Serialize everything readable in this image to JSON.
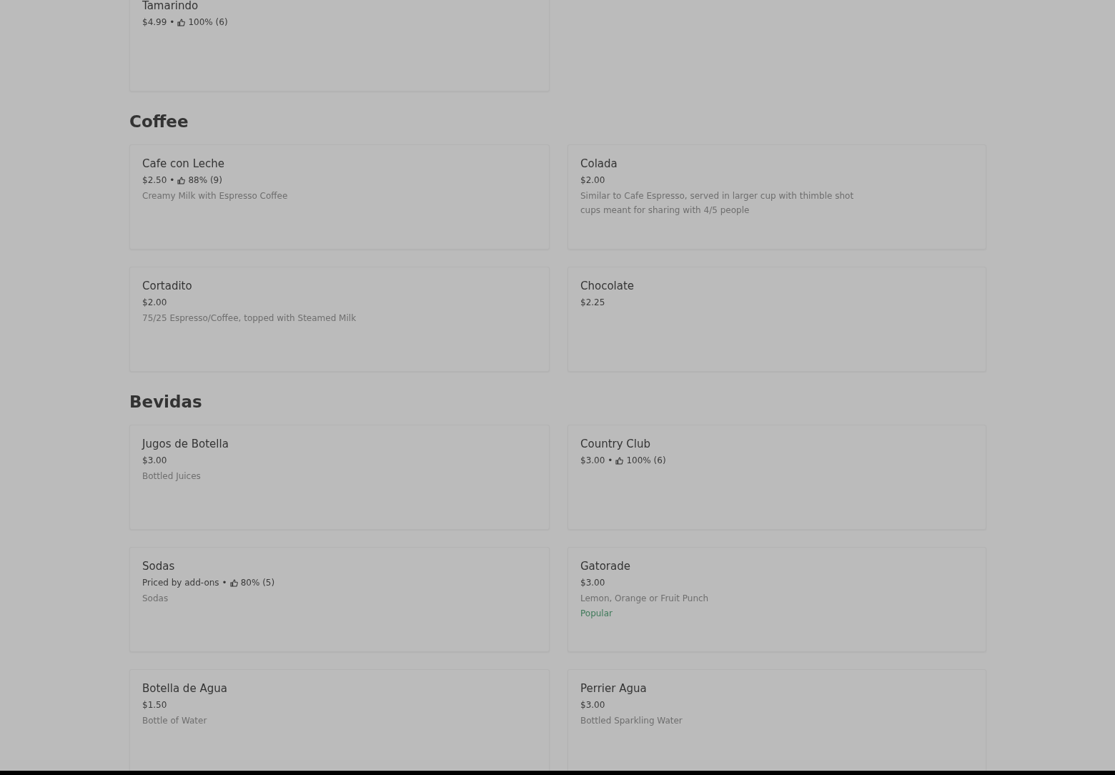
{
  "sections": [
    {
      "items": [
        {
          "name": "Tamarindo",
          "price": "$4.99",
          "separator": "•",
          "rating": "100% (6)"
        }
      ]
    },
    {
      "title": "Coffee",
      "items": [
        {
          "name": "Cafe con Leche",
          "price": "$2.50",
          "separator": "•",
          "rating": "88% (9)",
          "description": "Creamy Milk with Espresso Coffee"
        },
        {
          "name": "Colada",
          "price": "$2.00",
          "description": "Similar to Cafe Espresso, served in larger cup with thimble shot cups meant for sharing with 4/5 people"
        },
        {
          "name": "Cortadito",
          "price": "$2.00",
          "description": "75/25 Espresso/Coffee, topped with Steamed Milk"
        },
        {
          "name": "Chocolate",
          "price": "$2.25"
        }
      ]
    },
    {
      "title": "Bevidas",
      "items": [
        {
          "name": "Jugos de Botella",
          "price": "$3.00",
          "description": "Bottled Juices"
        },
        {
          "name": "Country Club",
          "price": "$3.00",
          "separator": "•",
          "rating": "100% (6)"
        },
        {
          "name": "Sodas",
          "price": "Priced by add-ons",
          "separator": "•",
          "rating": "80% (5)",
          "description": "Sodas"
        },
        {
          "name": "Gatorade",
          "price": "$3.00",
          "description": "Lemon, Orange or Fruit Punch",
          "badge": "Popular"
        },
        {
          "name": "Botella de Agua",
          "price": "$1.50",
          "description": "Bottle of Water"
        },
        {
          "name": "Perrier Agua",
          "price": "$3.00",
          "description": "Bottled Sparkling Water"
        }
      ]
    }
  ]
}
